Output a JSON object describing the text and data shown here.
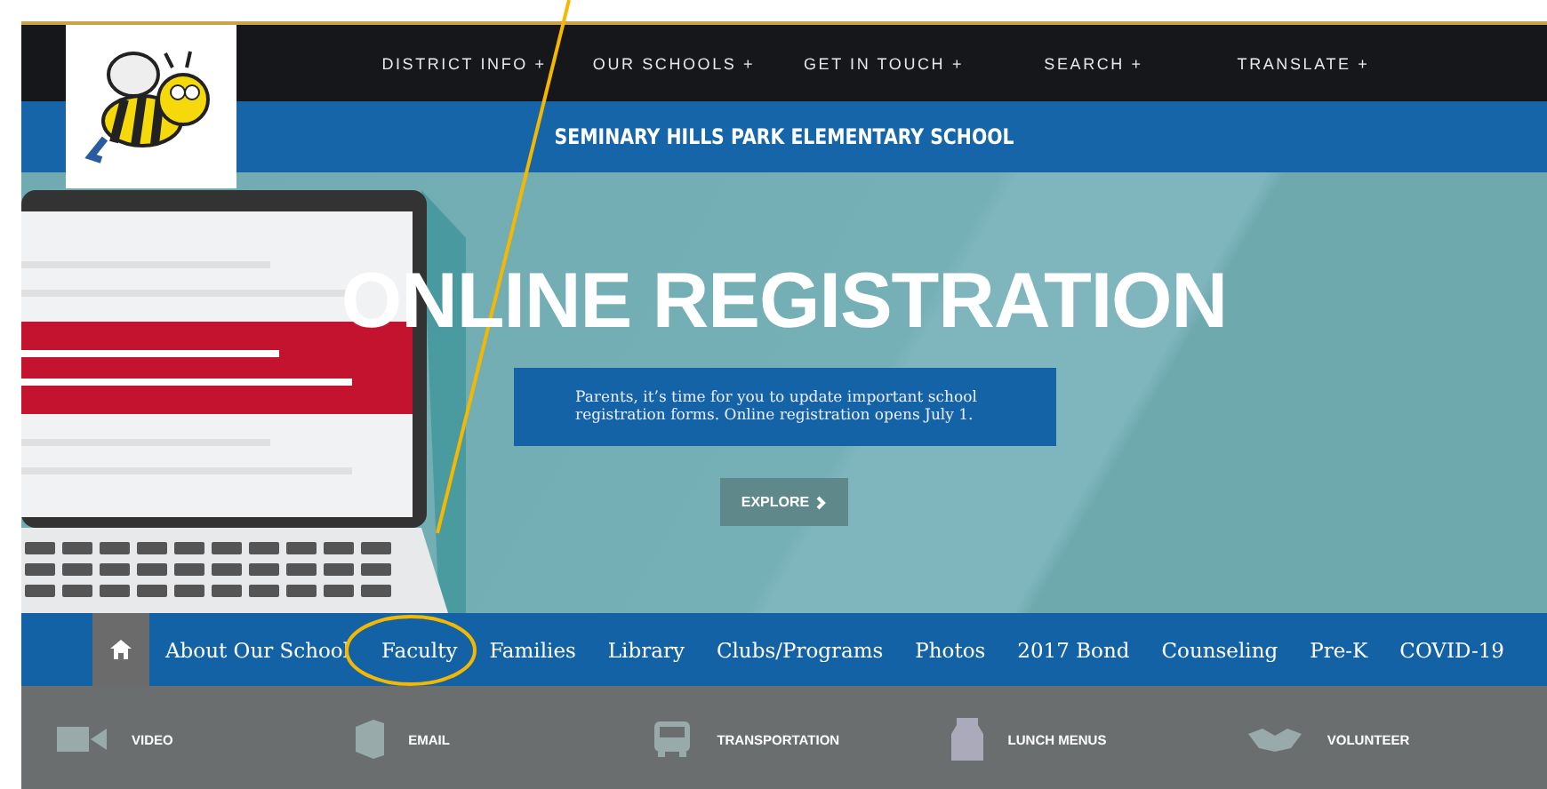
{
  "top_nav": [
    {
      "label": "DISTRICT INFO",
      "icon": "+"
    },
    {
      "label": "OUR SCHOOLS",
      "icon": "+"
    },
    {
      "label": "GET IN TOUCH",
      "icon": "+"
    },
    {
      "label": "SEARCH",
      "icon": "+"
    },
    {
      "label": "TRANSLATE",
      "icon": "+"
    }
  ],
  "school_name": "SEMINARY HILLS PARK ELEMENTARY SCHOOL",
  "hero": {
    "title": "ONLINE REGISTRATION",
    "message": "Parents, it’s time for you to update important school registration forms. Online registration opens July 1.",
    "button": "EXPLORE"
  },
  "main_nav": [
    {
      "kind": "home",
      "selected": true
    },
    {
      "kind": "link",
      "label": "About Our School",
      "selected": false
    },
    {
      "kind": "link",
      "label": "Faculty",
      "selected": false
    },
    {
      "kind": "link",
      "label": "Families",
      "selected": false
    },
    {
      "kind": "link",
      "label": "Library",
      "selected": false
    },
    {
      "kind": "link",
      "label": "Clubs/Programs",
      "selected": false
    },
    {
      "kind": "link",
      "label": "Photos",
      "selected": false
    },
    {
      "kind": "link",
      "label": "2017 Bond",
      "selected": false
    },
    {
      "kind": "link",
      "label": "Counseling",
      "selected": false
    },
    {
      "kind": "link",
      "label": "Pre-K",
      "selected": false
    },
    {
      "kind": "link",
      "label": "COVID-19",
      "selected": false
    }
  ],
  "quick_links": [
    {
      "kind": "video",
      "label": "VIDEO"
    },
    {
      "kind": "email",
      "label": "EMAIL"
    },
    {
      "kind": "bus",
      "label": "TRANSPORTATION"
    },
    {
      "kind": "lunch",
      "label": "LUNCH MENUS"
    },
    {
      "kind": "volunteer",
      "label": "VOLUNTEER"
    }
  ],
  "annotations": {
    "pointer_line": {
      "color": "#f5b800"
    },
    "highlight_ellipse": {
      "color": "#f5b800"
    }
  }
}
